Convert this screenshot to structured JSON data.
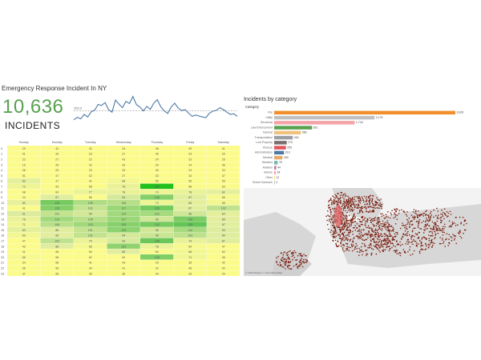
{
  "header": {
    "title": "Emergency Response Incident In NY",
    "total": "10,636",
    "total_label": "INCIDENTS"
  },
  "sparkline": {
    "reference_label": "265.9",
    "reference_value": 265.9,
    "values": [
      238,
      246,
      241,
      255,
      247,
      263,
      268,
      286,
      283,
      292,
      270,
      262,
      300,
      287,
      276,
      296,
      289,
      311,
      286,
      278,
      266,
      280,
      271,
      290,
      301,
      279,
      266,
      258,
      278,
      290,
      275,
      267,
      270,
      259,
      249,
      253,
      250,
      247,
      245,
      259,
      265,
      268,
      276,
      270,
      262,
      255,
      257,
      249
    ]
  },
  "bar_panel": {
    "title": "Incidents by category",
    "legend_header": "Category"
  },
  "chart_data": [
    {
      "type": "bar",
      "orientation": "horizontal",
      "title": "Incidents by category",
      "categories": [
        "Fire",
        "Utility",
        "Structural",
        "Law Enforcement",
        "Hazmat",
        "Transportation",
        "Lost Property",
        "Rescue",
        "Administration",
        "Medical",
        "Weather",
        "Aviation",
        "Marine",
        "Other",
        "Brand Outreach"
      ],
      "values": [
        3926,
        2175,
        1744,
        821,
        580,
        404,
        272,
        255,
        213,
        180,
        76,
        44,
        34,
        12,
        2
      ],
      "value_labels": [
        "3,926",
        "2,175",
        "1,744",
        "821",
        "580",
        "404",
        "272",
        "255",
        "213",
        "180",
        "76",
        "44",
        "34",
        "12",
        "2"
      ],
      "colors": [
        "#f28e2b",
        "#c0c0c0",
        "#f4a3a8",
        "#59a14f",
        "#f1c27d",
        "#9ca0a4",
        "#79706e",
        "#e15759",
        "#4e79a7",
        "#e5a96b",
        "#76b7b2",
        "#b07aa1",
        "#ff9da7",
        "#f6d55c",
        "#bab0ac"
      ]
    },
    {
      "type": "heatmap",
      "columns": [
        "Sunday",
        "Monday",
        "Tuesday",
        "Wednesday",
        "Thursday",
        "Friday",
        "Saturday"
      ],
      "rows": [
        "0",
        "1",
        "2",
        "3",
        "4",
        "5",
        "6",
        "7",
        "8",
        "9",
        "10",
        "11",
        "12",
        "13",
        "14",
        "15",
        "16",
        "17",
        "18",
        "19",
        "20",
        "21",
        "22",
        "23"
      ],
      "values": [
        [
          29,
          42,
          32,
          34,
          38,
          39,
          41
        ],
        [
          41,
          26,
          23,
          27,
          45,
          29,
          29
        ],
        [
          23,
          27,
          22,
          43,
          24,
          23,
          25
        ],
        [
          16,
          26,
          42,
          43,
          29,
          34,
          46
        ],
        [
          26,
          25,
          23,
          33,
          40,
          24,
          34
        ],
        [
          51,
          47,
          32,
          27,
          33,
          34,
          47
        ],
        [
          83,
          37,
          41,
          68,
          50,
          56,
          55
        ],
        [
          72,
          53,
          58,
          78,
          166,
          58,
          53
        ],
        [
          48,
          64,
          77,
          78,
          74,
          78,
          82
        ],
        [
          24,
          87,
          56,
          94,
          126,
          87,
          65
        ],
        [
          80,
          132,
          109,
          106,
          73,
          85,
          68
        ],
        [
          41,
          126,
          101,
          117,
          133,
          87,
          102
        ],
        [
          91,
          101,
          95,
          114,
          113,
          96,
          84
        ],
        [
          78,
          114,
          105,
          117,
          96,
          130,
          86
        ],
        [
          71,
          106,
          115,
          125,
          132,
          139,
          87
        ],
        [
          83,
          88,
          101,
          123,
          95,
          112,
          90
        ],
        [
          69,
          86,
          101,
          94,
          98,
          103,
          89
        ],
        [
          47,
          102,
          76,
          93,
          136,
          79,
          87
        ],
        [
          43,
          88,
          66,
          122,
          78,
          64,
          47
        ],
        [
          41,
          56,
          60,
          86,
          64,
          68,
          62
        ],
        [
          65,
          58,
          52,
          54,
          128,
          71,
          36
        ],
        [
          34,
          56,
          41,
          43,
          29,
          36,
          42
        ],
        [
          36,
          56,
          34,
          41,
          32,
          46,
          42
        ],
        [
          37,
          55,
          35,
          36,
          44,
          33,
          34
        ]
      ]
    }
  ],
  "map": {
    "credit": "© 2023 Mapbox © OpenStreetMap"
  }
}
